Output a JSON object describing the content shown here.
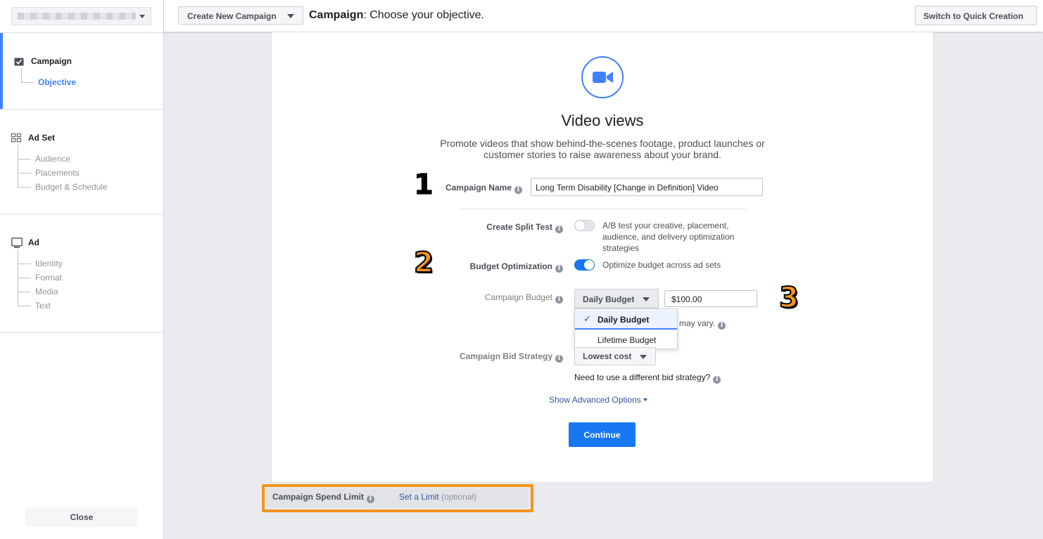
{
  "header": {
    "create_button": "Create New Campaign",
    "heading_bold": "Campaign",
    "heading_rest": ": Choose your objective.",
    "quick_creation_button": "Switch to Quick Creation"
  },
  "sidebar": {
    "campaign": {
      "title": "Campaign",
      "items": [
        "Objective"
      ]
    },
    "ad_set": {
      "title": "Ad Set",
      "items": [
        "Audience",
        "Placements",
        "Budget & Schedule"
      ]
    },
    "ad": {
      "title": "Ad",
      "items": [
        "Identity",
        "Format",
        "Media",
        "Text"
      ]
    },
    "close_button": "Close"
  },
  "objective": {
    "icon": "video-camera-icon",
    "title": "Video views",
    "description": "Promote videos that show behind-the-scenes footage, product launches or customer stories to raise awareness about your brand."
  },
  "form": {
    "campaign_name_label": "Campaign Name",
    "campaign_name_value": "Long Term Disability [Change in Definition] Video",
    "split_test_label": "Create Split Test",
    "split_test_enabled": false,
    "split_test_text": "A/B test your creative, placement, audience, and delivery optimization strategies",
    "budget_opt_label": "Budget Optimization",
    "budget_opt_enabled": true,
    "budget_opt_text": "Optimize budget across ad sets",
    "campaign_budget_label": "Campaign Budget",
    "budget_type_selected": "Daily Budget",
    "budget_amount": "$100.00",
    "budget_menu_options": [
      "Daily Budget",
      "Lifetime Budget"
    ],
    "budget_note_visible": "may vary.",
    "bid_strategy_label": "Campaign Bid Strategy",
    "bid_strategy_value": "Lowest cost",
    "bid_strategy_help": "Need to use a different bid strategy?",
    "advanced_link": "Show Advanced Options",
    "continue_button": "Continue"
  },
  "annotations": {
    "one": "1",
    "two": "2",
    "three": "3",
    "highlight_color": "#f7931e"
  },
  "spend_limit": {
    "label": "Campaign Spend Limit",
    "link": "Set a Limit",
    "optional": "(optional)"
  },
  "colors": {
    "accent": "#4080ff",
    "primary_button": "#1877f2",
    "link": "#365899"
  }
}
